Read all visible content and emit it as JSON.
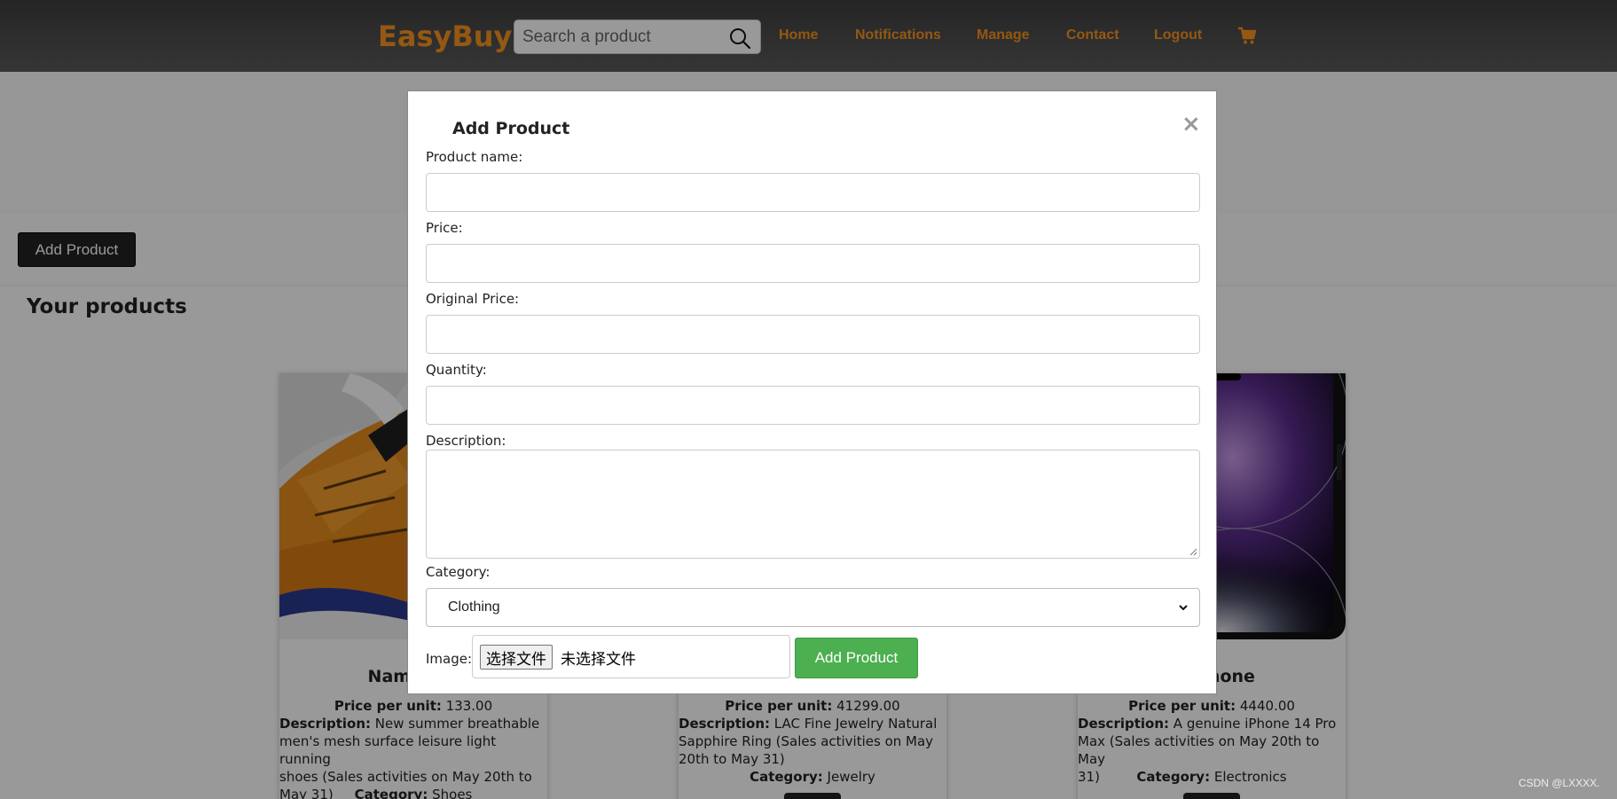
{
  "header": {
    "brand": "EasyBuy",
    "search_placeholder": "Search a product",
    "nav": [
      "Home",
      "Notifications",
      "Manage",
      "Contact",
      "Logout"
    ]
  },
  "page": {
    "add_button": "Add Product",
    "section_title": "Your products"
  },
  "products": [
    {
      "name": "Name: Sp",
      "price_label": "Price per unit:",
      "price": "133.00",
      "desc_label": "Description:",
      "desc_lines": [
        "New summer breathable",
        "men's mesh surface leisure light running",
        "shoes (Sales activities on May 20th to",
        "May 31)"
      ],
      "category_label": "Category:",
      "category": "Shoes"
    },
    {
      "name": "",
      "price_label": "Price per unit:",
      "price": "41299.00",
      "desc_label": "Description:",
      "desc_lines": [
        "LAC Fine Jewelry Natural",
        "Sapphire Ring (Sales activities on May",
        "20th to May 31)"
      ],
      "category_label": "Category:",
      "category": "Jewelry"
    },
    {
      "name": "artphone",
      "price_label": "Price per unit:",
      "price": "4440.00",
      "desc_label": "Description:",
      "desc_lines": [
        "A genuine iPhone 14 Pro",
        "Max (Sales activities on May 20th to May",
        "31)"
      ],
      "category_label": "Category:",
      "category": "Electronics"
    }
  ],
  "modal": {
    "title": "Add Product",
    "close_symbol": "×",
    "labels": {
      "name": "Product name:",
      "price": "Price:",
      "original_price": "Original Price:",
      "quantity": "Quantity:",
      "description": "Description:",
      "category": "Category:",
      "image": "Image:"
    },
    "category_selected": "Clothing",
    "file_button": "选择文件",
    "file_status": "未选择文件",
    "submit": "Add Product"
  },
  "watermark": "CSDN @LXXXX.",
  "colors": {
    "brand": "#f7931e",
    "submit": "#4caf50"
  }
}
